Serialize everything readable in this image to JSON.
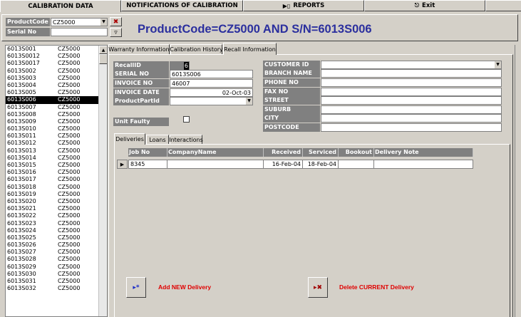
{
  "top_tabs": [
    {
      "label": "CALIBRATION DATA"
    },
    {
      "label": "NOTIFICATIONS OF CALIBRATION"
    },
    {
      "label": "REPORTS"
    },
    {
      "label": "Exit"
    }
  ],
  "filter": {
    "product_code_label": "ProductCode",
    "product_code_value": "CZ5000",
    "serial_no_label": "Serial No",
    "serial_no_value": ""
  },
  "title": "ProductCode=CZ5000 AND S/N=6013S006",
  "list_rows": [
    [
      "6013S001",
      "CZ5000"
    ],
    [
      "6013S0012",
      "CZ5000"
    ],
    [
      "6013S0017",
      "CZ5000"
    ],
    [
      "6013S002",
      "CZ5000"
    ],
    [
      "6013S003",
      "CZ5000"
    ],
    [
      "6013S004",
      "CZ5000"
    ],
    [
      "6013S005",
      "CZ5000"
    ],
    [
      "6013S006",
      "CZ5000"
    ],
    [
      "6013S007",
      "CZ5000"
    ],
    [
      "6013S008",
      "CZ5000"
    ],
    [
      "6013S009",
      "CZ5000"
    ],
    [
      "6013S010",
      "CZ5000"
    ],
    [
      "6013S011",
      "CZ5000"
    ],
    [
      "6013S012",
      "CZ5000"
    ],
    [
      "6013S013",
      "CZ5000"
    ],
    [
      "6013S014",
      "CZ5000"
    ],
    [
      "6013S015",
      "CZ5000"
    ],
    [
      "6013S016",
      "CZ5000"
    ],
    [
      "6013S017",
      "CZ5000"
    ],
    [
      "6013S018",
      "CZ5000"
    ],
    [
      "6013S019",
      "CZ5000"
    ],
    [
      "6013S020",
      "CZ5000"
    ],
    [
      "6013S021",
      "CZ5000"
    ],
    [
      "6013S022",
      "CZ5000"
    ],
    [
      "6013S023",
      "CZ5000"
    ],
    [
      "6013S024",
      "CZ5000"
    ],
    [
      "6013S025",
      "CZ5000"
    ],
    [
      "6013S026",
      "CZ5000"
    ],
    [
      "6013S027",
      "CZ5000"
    ],
    [
      "6013S028",
      "CZ5000"
    ],
    [
      "6013S029",
      "CZ5000"
    ],
    [
      "6013S030",
      "CZ5000"
    ],
    [
      "6013S031",
      "CZ5000"
    ],
    [
      "6013S032",
      "CZ5000"
    ]
  ],
  "selected_row": "6013S006",
  "record_tabs": [
    "Warranty Information",
    "Calibration History",
    "Recall Information"
  ],
  "fields": {
    "recall_id_label": "RecallID",
    "recall_id": "6",
    "serial_no_label": "SERIAL NO",
    "serial_no": "6013S006",
    "invoice_no_label": "INVOICE NO",
    "invoice_no": "46007",
    "invoice_date_label": "INVOICE DATE",
    "invoice_date": "02-Oct-03",
    "product_part_id_label": "ProductPartId",
    "product_part_id": "",
    "unit_faulty_label": "Unit Faulty",
    "customer_id_label": "CUSTOMER ID",
    "branch_name_label": "BRANCH NAME",
    "phone_no_label": "PHONE NO",
    "fax_no_label": "FAX NO",
    "street_label": "STREET",
    "suburb_label": "SUBURB",
    "city_label": "CITY",
    "postcode_label": "POSTCODE"
  },
  "sub_tabs": [
    "Deliveries",
    "Loans",
    "Interactions"
  ],
  "grid": {
    "headers": [
      "Job No",
      "CompanyName",
      "Received",
      "Serviced",
      "Bookout",
      "Delivery Note"
    ],
    "rows": [
      [
        "8345",
        "",
        "16-Feb-04",
        "18-Feb-04",
        "",
        ""
      ]
    ]
  },
  "actions": {
    "add_label": "Add NEW Delivery",
    "delete_label": "Delete CURRENT Delivery"
  },
  "colors": {
    "title": "#2b2f9e",
    "action_text": "#e00000",
    "label_bg": "#808080"
  }
}
